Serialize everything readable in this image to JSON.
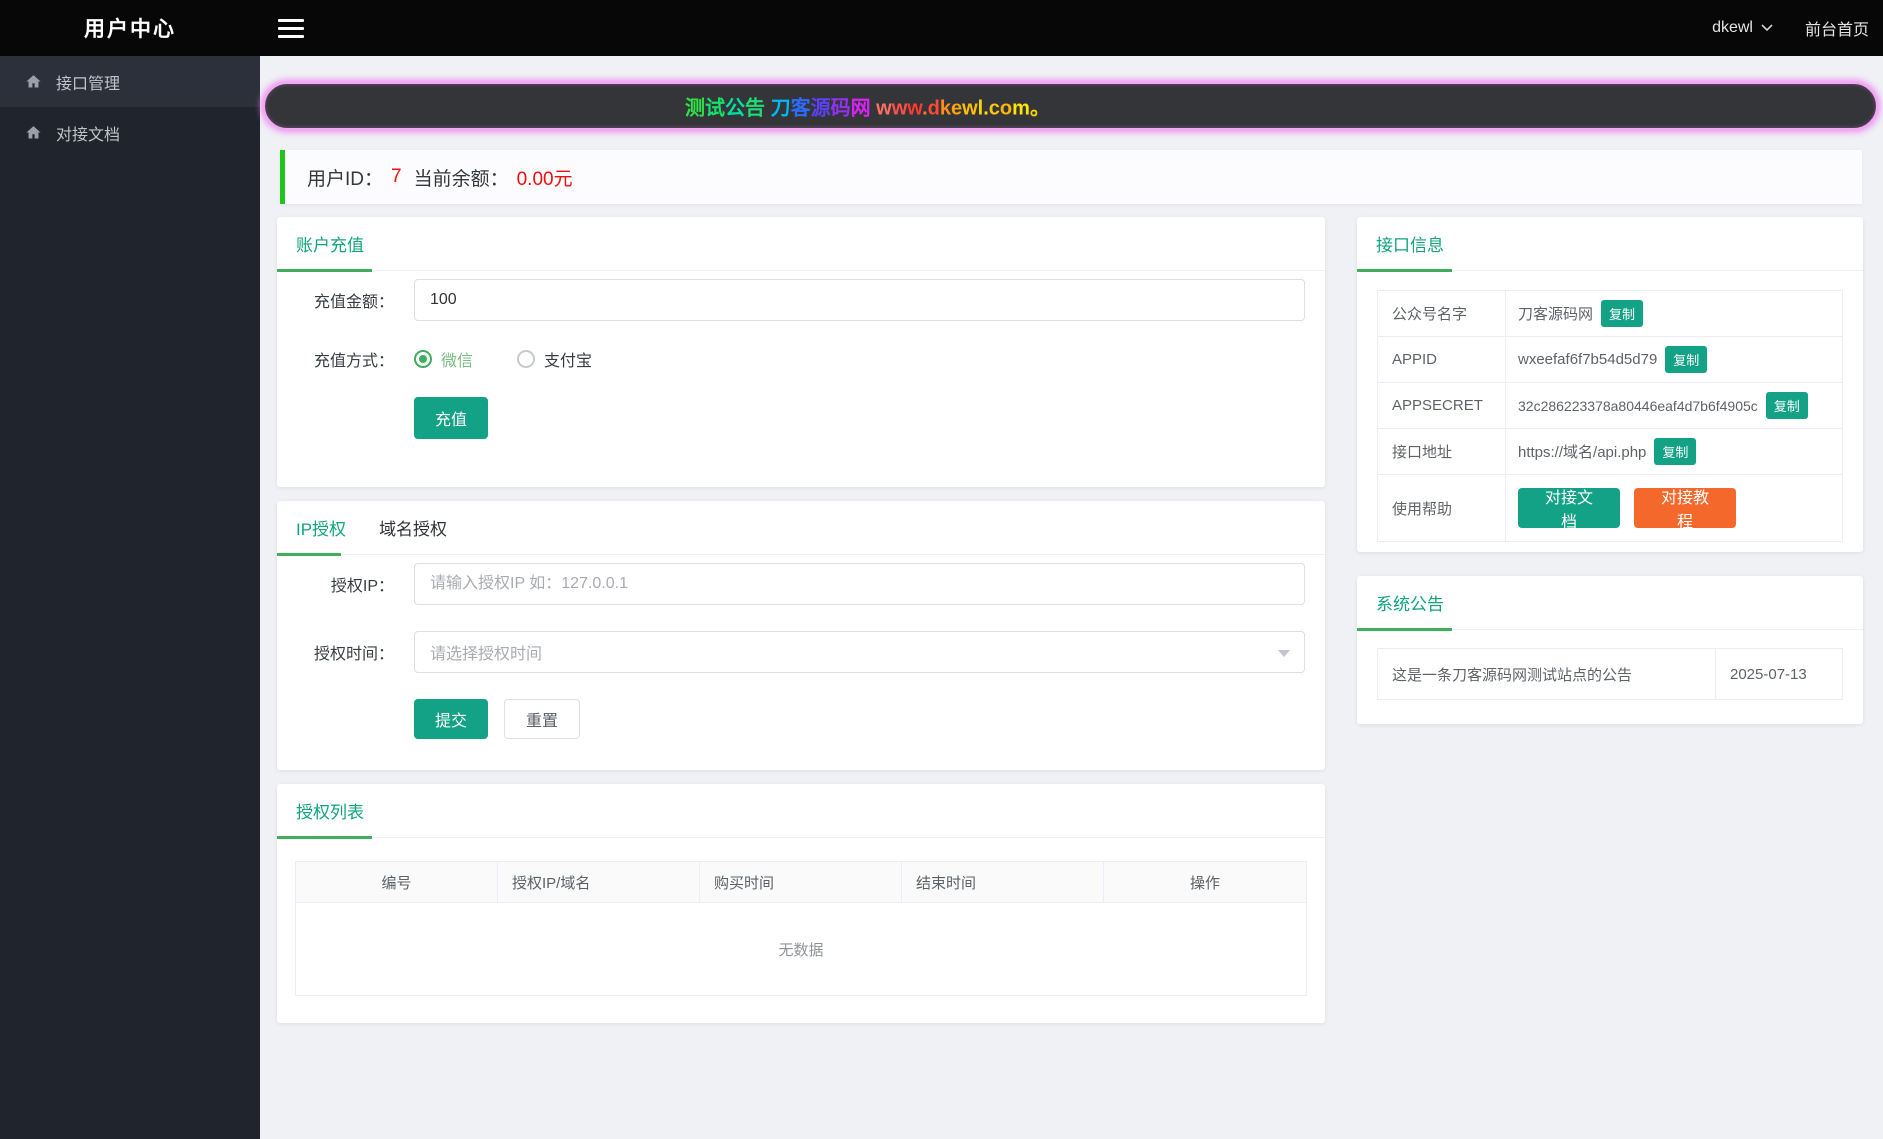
{
  "topbar": {
    "title": "用户中心",
    "username": "dkewl",
    "home_link": "前台首页"
  },
  "sidebar": {
    "items": [
      {
        "label": "接口管理"
      },
      {
        "label": "对接文档"
      }
    ]
  },
  "announcement": {
    "chars": [
      [
        "测",
        "#2fe049"
      ],
      [
        "试",
        "#15e26a"
      ],
      [
        "公",
        "#00e29b"
      ],
      [
        "告",
        "#1fdc74"
      ],
      [
        " ",
        ""
      ],
      [
        "刀",
        "#00b8f5"
      ],
      [
        "客",
        "#2d6cfb"
      ],
      [
        "源",
        "#5a41f2"
      ],
      [
        "码",
        "#9232f0"
      ],
      [
        "网",
        "#d524f5"
      ],
      [
        " ",
        ""
      ],
      [
        "w",
        "#ff6f61"
      ],
      [
        "w",
        "#ff5148"
      ],
      [
        "w",
        "#ff3b30"
      ],
      [
        ".",
        "#ff7a21"
      ],
      [
        "d",
        "#ff4a36"
      ],
      [
        "k",
        "#ff8d1a"
      ],
      [
        "e",
        "#ffa312"
      ],
      [
        "w",
        "#ffbe08"
      ],
      [
        "l",
        "#ffd400"
      ],
      [
        ".",
        "#ffe01e"
      ],
      [
        "c",
        "#ffc414"
      ],
      [
        "o",
        "#ffb60c"
      ],
      [
        "m",
        "#ffe600"
      ],
      [
        "。",
        "#ffd700"
      ]
    ]
  },
  "user_bar": {
    "id_label": "用户ID：",
    "id_value": "7",
    "balance_label": "当前余额：",
    "balance_value": "0.00元"
  },
  "recharge": {
    "title": "账户充值",
    "amount_label": "充值金额：",
    "amount_value": "100",
    "method_label": "充值方式：",
    "methods": [
      {
        "label": "微信",
        "checked": true
      },
      {
        "label": "支付宝",
        "checked": false
      }
    ],
    "submit": "充值"
  },
  "auth": {
    "tab_ip": "IP授权",
    "tab_domain": "域名授权",
    "ip_label": "授权IP：",
    "ip_placeholder": "请输入授权IP 如：127.0.0.1",
    "time_label": "授权时间：",
    "time_placeholder": "请选择授权时间",
    "submit": "提交",
    "reset": "重置"
  },
  "auth_list": {
    "title": "授权列表",
    "columns": [
      "编号",
      "授权IP/域名",
      "购买时间",
      "结束时间",
      "操作"
    ],
    "empty": "无数据"
  },
  "api_info": {
    "title": "接口信息",
    "copy": "复制",
    "rows": [
      {
        "label": "公众号名字",
        "value": "刀客源码网"
      },
      {
        "label": "APPID",
        "value": "wxeefaf6f7b54d5d79"
      },
      {
        "label": "APPSECRET",
        "value": "32c286223378a80446eaf4d7b6f4905c"
      },
      {
        "label": "接口地址",
        "value": "https://域名/api.php"
      }
    ],
    "help_label": "使用帮助",
    "help_doc": "对接文档",
    "help_tutorial": "对接教程"
  },
  "notice": {
    "title": "系统公告",
    "text": "这是一条刀客源码网测试站点的公告",
    "date": "2025-07-13"
  },
  "colors": {
    "teal": "#13a286",
    "green": "#3fae5e",
    "orange": "#f5682b",
    "red": "#f20d0d",
    "title_teal": "#10a37f",
    "accent_pink": "#f2a8f4"
  }
}
